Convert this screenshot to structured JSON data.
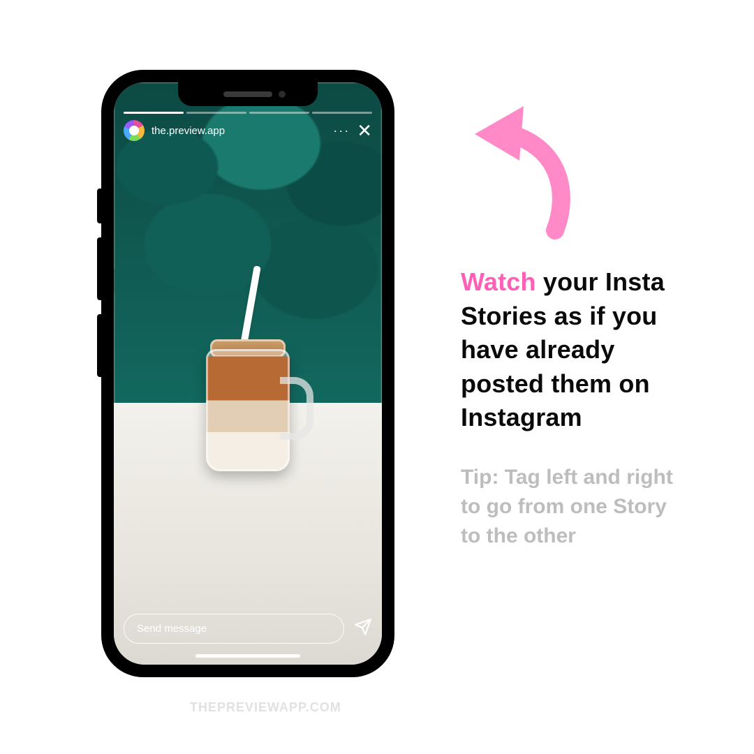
{
  "story": {
    "username": "the.preview.app",
    "progress_segments": 4,
    "more_label": "···",
    "close_label": "✕",
    "message_placeholder": "Send message"
  },
  "copy": {
    "accent_word": "Watch",
    "headline_rest": " your Insta Stories as if you have already posted them on Instagram",
    "tip": "Tip: Tag left and right to go from one Story to the other"
  },
  "watermark": "THEPREVIEWAPP.COM",
  "colors": {
    "accent_pink": "#ff5fb6",
    "tip_grey": "#bdbdbd"
  }
}
